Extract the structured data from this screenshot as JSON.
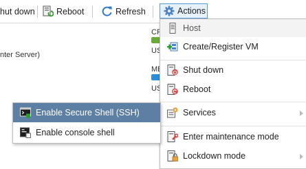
{
  "toolbar": {
    "shutdown_label": "hut down",
    "reboot_label": "Reboot",
    "refresh_label": "Refresh",
    "actions_label": "Actions"
  },
  "background": {
    "server_text": "nter Server)",
    "cpu_label": "CF",
    "cpu_used": "US",
    "mem_label": "ME",
    "mem_used": "US"
  },
  "actions_menu": {
    "header": "Host",
    "items": [
      {
        "label": "Create/Register VM",
        "icon": "create-vm-icon"
      },
      {
        "label": "Shut down",
        "icon": "shutdown-icon"
      },
      {
        "label": "Reboot",
        "icon": "reboot-icon"
      },
      {
        "label": "Services",
        "icon": "services-icon",
        "submenu": true
      },
      {
        "label": "Enter maintenance mode",
        "icon": "maintenance-icon"
      },
      {
        "label": "Lockdown mode",
        "icon": "lockdown-icon",
        "submenu": true
      }
    ]
  },
  "services_submenu": {
    "items": [
      {
        "label": "Enable Secure Shell (SSH)",
        "icon": "ssh-icon",
        "selected": true
      },
      {
        "label": "Enable console shell",
        "icon": "console-shell-icon"
      }
    ]
  },
  "colors": {
    "selection": "#5d7fa3",
    "accent_blue": "#2f7bc8",
    "bar_green": "#6aaa3a",
    "bar_blue": "#2b8fd6"
  }
}
